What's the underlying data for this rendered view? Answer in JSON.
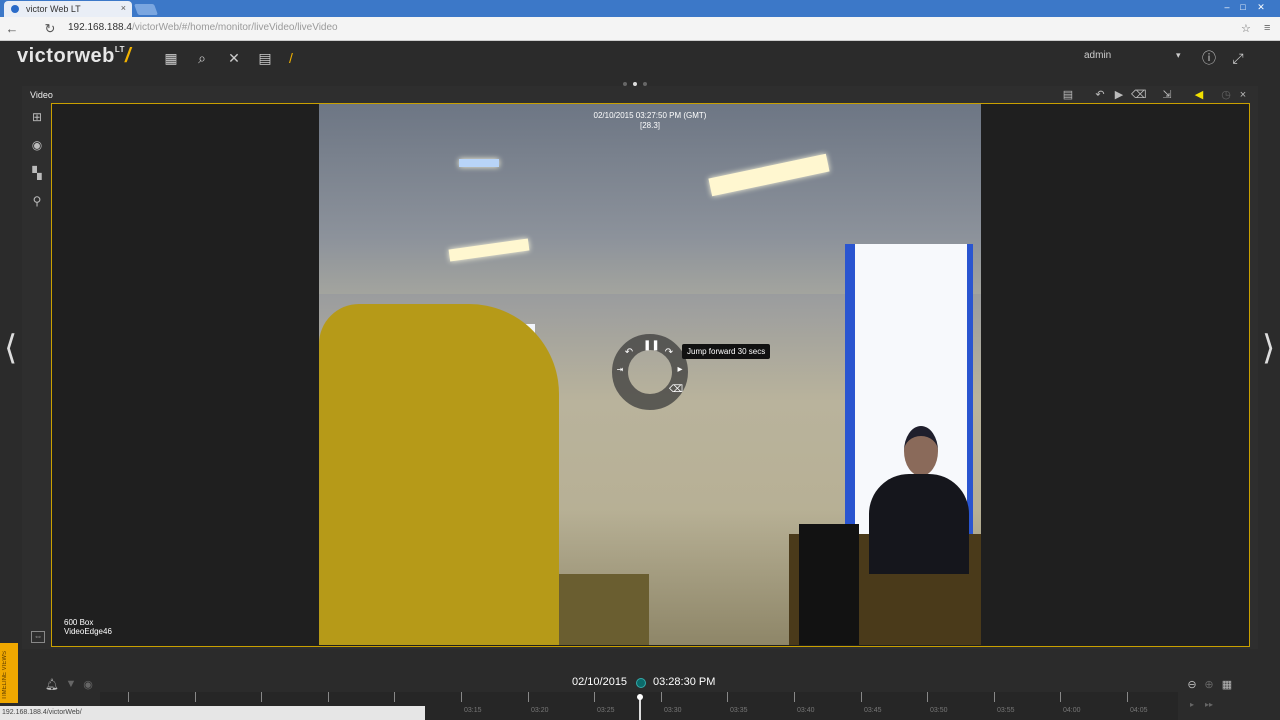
{
  "browser": {
    "tab_title": "victor Web LT",
    "tab_close": "×",
    "url_host": "192.168.188.4",
    "url_path": "/victorWeb/#/home/monitor/liveVideo/liveVideo",
    "status_url": "192.168.188.4/victorWeb/"
  },
  "header": {
    "logo_text": "victorweb",
    "logo_suffix": "LT",
    "logo_slash": "/",
    "user": "admin",
    "icons": [
      "grid-icon",
      "search-icon",
      "tools-icon",
      "reports-icon",
      "slash-icon",
      "info-icon",
      "fullscreen-icon"
    ]
  },
  "panel": {
    "title": "Video",
    "sidebar_icons": [
      "layout-grid-icon",
      "record-icon",
      "tiles-icon",
      "map-pin-icon"
    ],
    "toolbar_icons": [
      "list-icon",
      "rewind-icon",
      "play-icon",
      "eraser-icon",
      "export-icon",
      "audio-icon",
      "clock-icon",
      "close-icon"
    ]
  },
  "video": {
    "timestamp": "02/10/2015 03:27:50 PM (GMT)",
    "fps": "[28.3]",
    "camera_model": "600 Box",
    "camera_name": "VideoEdge46",
    "tooltip": "Jump forward 30 secs"
  },
  "timeline": {
    "date": "02/10/2015",
    "time": "03:28:30 PM",
    "labels": [
      "03:15",
      "03:20",
      "03:25",
      "03:30",
      "03:35",
      "03:40",
      "03:45",
      "03:50",
      "03:55",
      "04:00",
      "04:05"
    ],
    "tab_label": "TIMELINE VIEWS"
  },
  "colors": {
    "accent": "#f2b200",
    "viewport_border": "#c9a000",
    "background": "#2b2b2b"
  }
}
